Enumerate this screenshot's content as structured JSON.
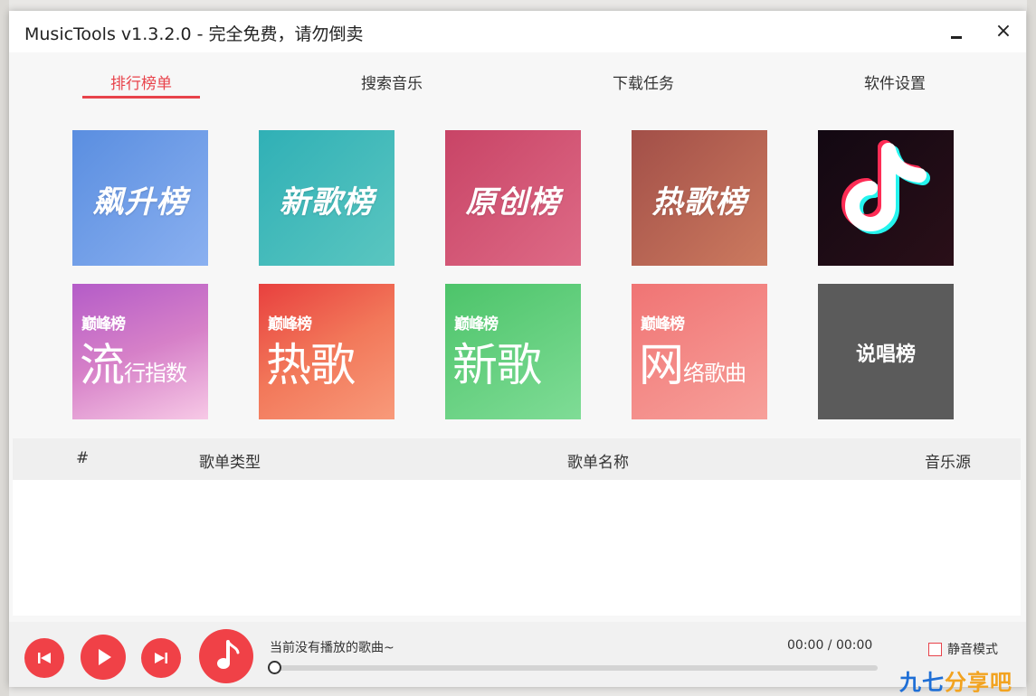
{
  "window": {
    "title": "MusicTools  v1.3.2.0 - 完全免费，请勿倒卖",
    "minimize": "—",
    "close": "×"
  },
  "tabs": [
    {
      "label": "排行榜单",
      "active": true
    },
    {
      "label": "搜索音乐",
      "active": false
    },
    {
      "label": "下载任务",
      "active": false
    },
    {
      "label": "软件设置",
      "active": false
    }
  ],
  "charts": [
    {
      "label": "飙升榜",
      "color": "#6f95e0"
    },
    {
      "label": "新歌榜",
      "color": "#42b6b8"
    },
    {
      "label": "原创榜",
      "color": "#d04d6f"
    },
    {
      "label": "热歌榜",
      "color": "#b86353"
    },
    {
      "label": "抖音",
      "icon": "douyin-logo-icon",
      "color": "#1b0d12"
    },
    {
      "brand": "巅峰榜",
      "label": "流",
      "sub": "行指数",
      "color": "#c26fd0"
    },
    {
      "brand": "巅峰榜",
      "label": "热歌",
      "sub": "",
      "color": "#ea5446"
    },
    {
      "brand": "巅峰榜",
      "label": "新歌",
      "sub": "",
      "color": "#58cc7a"
    },
    {
      "brand": "巅峰榜",
      "label": "网",
      "sub": "络歌曲",
      "color": "#f2807b"
    },
    {
      "label": "说唱榜",
      "color": "#5b5b5b"
    }
  ],
  "list": {
    "columns": [
      "#",
      "歌单类型",
      "歌单名称",
      "音乐源"
    ]
  },
  "player": {
    "now_playing": "当前没有播放的歌曲~",
    "time": "00:00 / 00:00",
    "progress": 0,
    "mute_label": "静音模式",
    "mute_checked": false
  },
  "watermark": {
    "part1": "九七",
    "part2": "分享吧"
  },
  "colors": {
    "accent": "#e8434b"
  }
}
